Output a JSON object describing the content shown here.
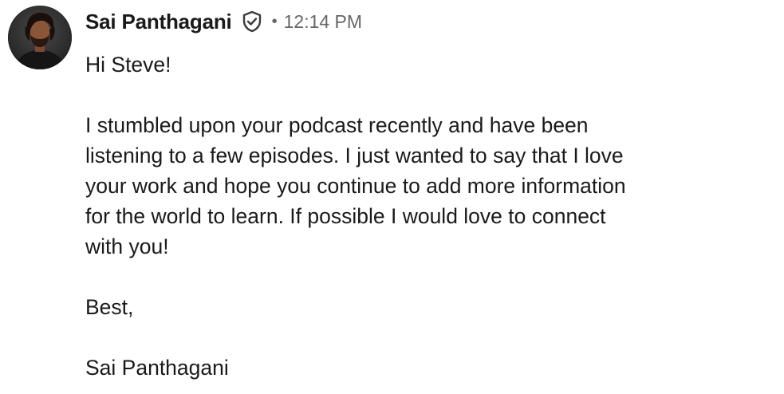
{
  "message": {
    "sender": {
      "name": "Sai Panthagani",
      "verified_icon": "shield-check-icon",
      "avatar": "avatar-photo"
    },
    "separator": "•",
    "timestamp": "12:14 PM",
    "body": {
      "greeting": "Hi Steve!",
      "paragraph_lines": [
        "I stumbled upon your podcast recently and have been",
        "listening to a few episodes. I just wanted to say that I love",
        "your work and hope you continue to add more information",
        "for the world to learn. If possible I would love to connect",
        "with you!"
      ],
      "closing": "Best,",
      "signature": "Sai Panthagani"
    }
  },
  "colors": {
    "text": "#1a1a1a",
    "muted": "#666666",
    "background": "#ffffff"
  }
}
